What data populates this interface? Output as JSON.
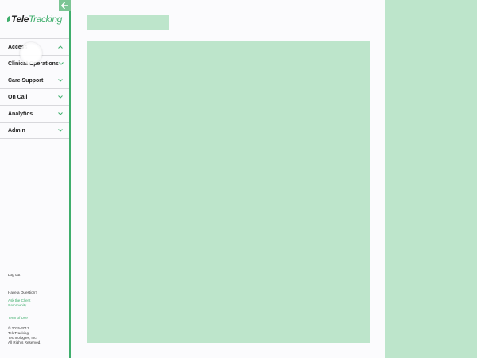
{
  "brand": {
    "logo_part1": "Tele",
    "logo_part2": "Tracking",
    "accent_color": "#3fae6c",
    "placeholder_color": "#bde5cb"
  },
  "sidebar": {
    "collapse_icon": "arrow-left-icon",
    "items": [
      {
        "label": "Access",
        "icon": "chevron-up-icon"
      },
      {
        "label": "Clinical Operations",
        "icon": "chevron-down-icon"
      },
      {
        "label": "Care Support",
        "icon": "chevron-down-icon"
      },
      {
        "label": "On Call",
        "icon": "chevron-down-icon"
      },
      {
        "label": "Analytics",
        "icon": "chevron-down-icon"
      },
      {
        "label": "Admin",
        "icon": "chevron-down-icon"
      }
    ],
    "footer": {
      "logout": "Log out",
      "question": "Have a Question?",
      "ask_line1": "Ask the Client",
      "ask_line2": "Community",
      "terms": "Term of Use",
      "copyright_line1": "© 2015-2017",
      "copyright_line2": "TeleTracking",
      "copyright_line3": "Technologies, Inc.",
      "copyright_line4": "All Rights Reserved."
    }
  }
}
